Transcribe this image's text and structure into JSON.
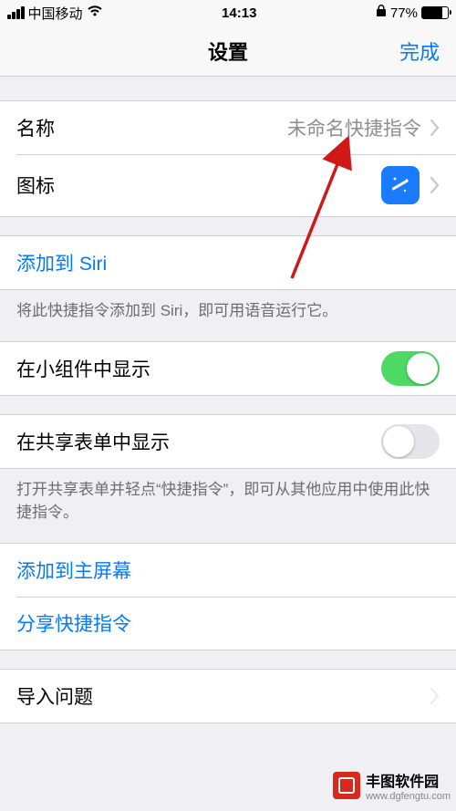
{
  "status": {
    "carrier": "中国移动",
    "time": "14:13",
    "battery_pct": "77%"
  },
  "nav": {
    "title": "设置",
    "done": "完成"
  },
  "rows": {
    "name_label": "名称",
    "name_value": "未命名快捷指令",
    "icon_label": "图标",
    "siri_label": "添加到 Siri",
    "siri_footer": "将此快捷指令添加到 Siri，即可用语音运行它。",
    "widget_label": "在小组件中显示",
    "widget_on": true,
    "share_sheet_label": "在共享表单中显示",
    "share_sheet_on": false,
    "share_sheet_footer": "打开共享表单并轻点“快捷指令”，即可从其他应用中使用此快捷指令。",
    "add_home_label": "添加到主屏幕",
    "share_shortcut_label": "分享快捷指令",
    "import_label": "导入问题"
  },
  "watermark": {
    "name": "丰图软件园",
    "url": "www.dgfengtu.com"
  }
}
